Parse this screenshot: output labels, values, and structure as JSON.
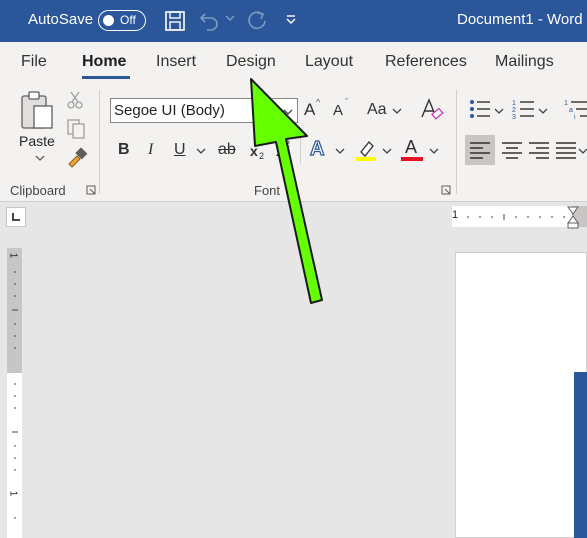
{
  "titlebar": {
    "autosave_label": "AutoSave",
    "autosave_state": "Off",
    "document_title": "Document1 - Word",
    "color": "#2b579a"
  },
  "tabs": [
    {
      "label": "File",
      "active": false
    },
    {
      "label": "Home",
      "active": true
    },
    {
      "label": "Insert",
      "active": false
    },
    {
      "label": "Design",
      "active": false
    },
    {
      "label": "Layout",
      "active": false
    },
    {
      "label": "References",
      "active": false
    },
    {
      "label": "Mailings",
      "active": false
    }
  ],
  "ribbon": {
    "clipboard": {
      "paste_label": "Paste",
      "group_label": "Clipboard",
      "icons": [
        "paste-icon",
        "cut-icon",
        "copy-icon",
        "format-painter-icon"
      ]
    },
    "font": {
      "font_name": "Segoe UI (Body)",
      "group_label": "Font",
      "buttons": {
        "bold": "B",
        "italic": "I",
        "underline": "U",
        "strikethrough": "ab",
        "subscript": "x",
        "subscript_mark": "2",
        "superscript": "x",
        "superscript_mark": "2",
        "grow": "A",
        "shrink": "A",
        "change_case": "Aa",
        "text_effects": "A",
        "font_color": "A"
      },
      "highlight_color": "#ffff00",
      "font_color_value": "#e81123"
    },
    "paragraph": {
      "icons": [
        "bullets-icon",
        "numbering-icon",
        "multilevel-list-icon",
        "align-left-icon",
        "align-center-icon",
        "align-right-icon",
        "justify-icon"
      ]
    }
  },
  "annotation": {
    "arrow_color": "#66ff00",
    "target": "tab-design"
  },
  "rulers": {
    "h_first_tick": "1",
    "v_first_tick": "1",
    "v_second_tick": "1"
  }
}
